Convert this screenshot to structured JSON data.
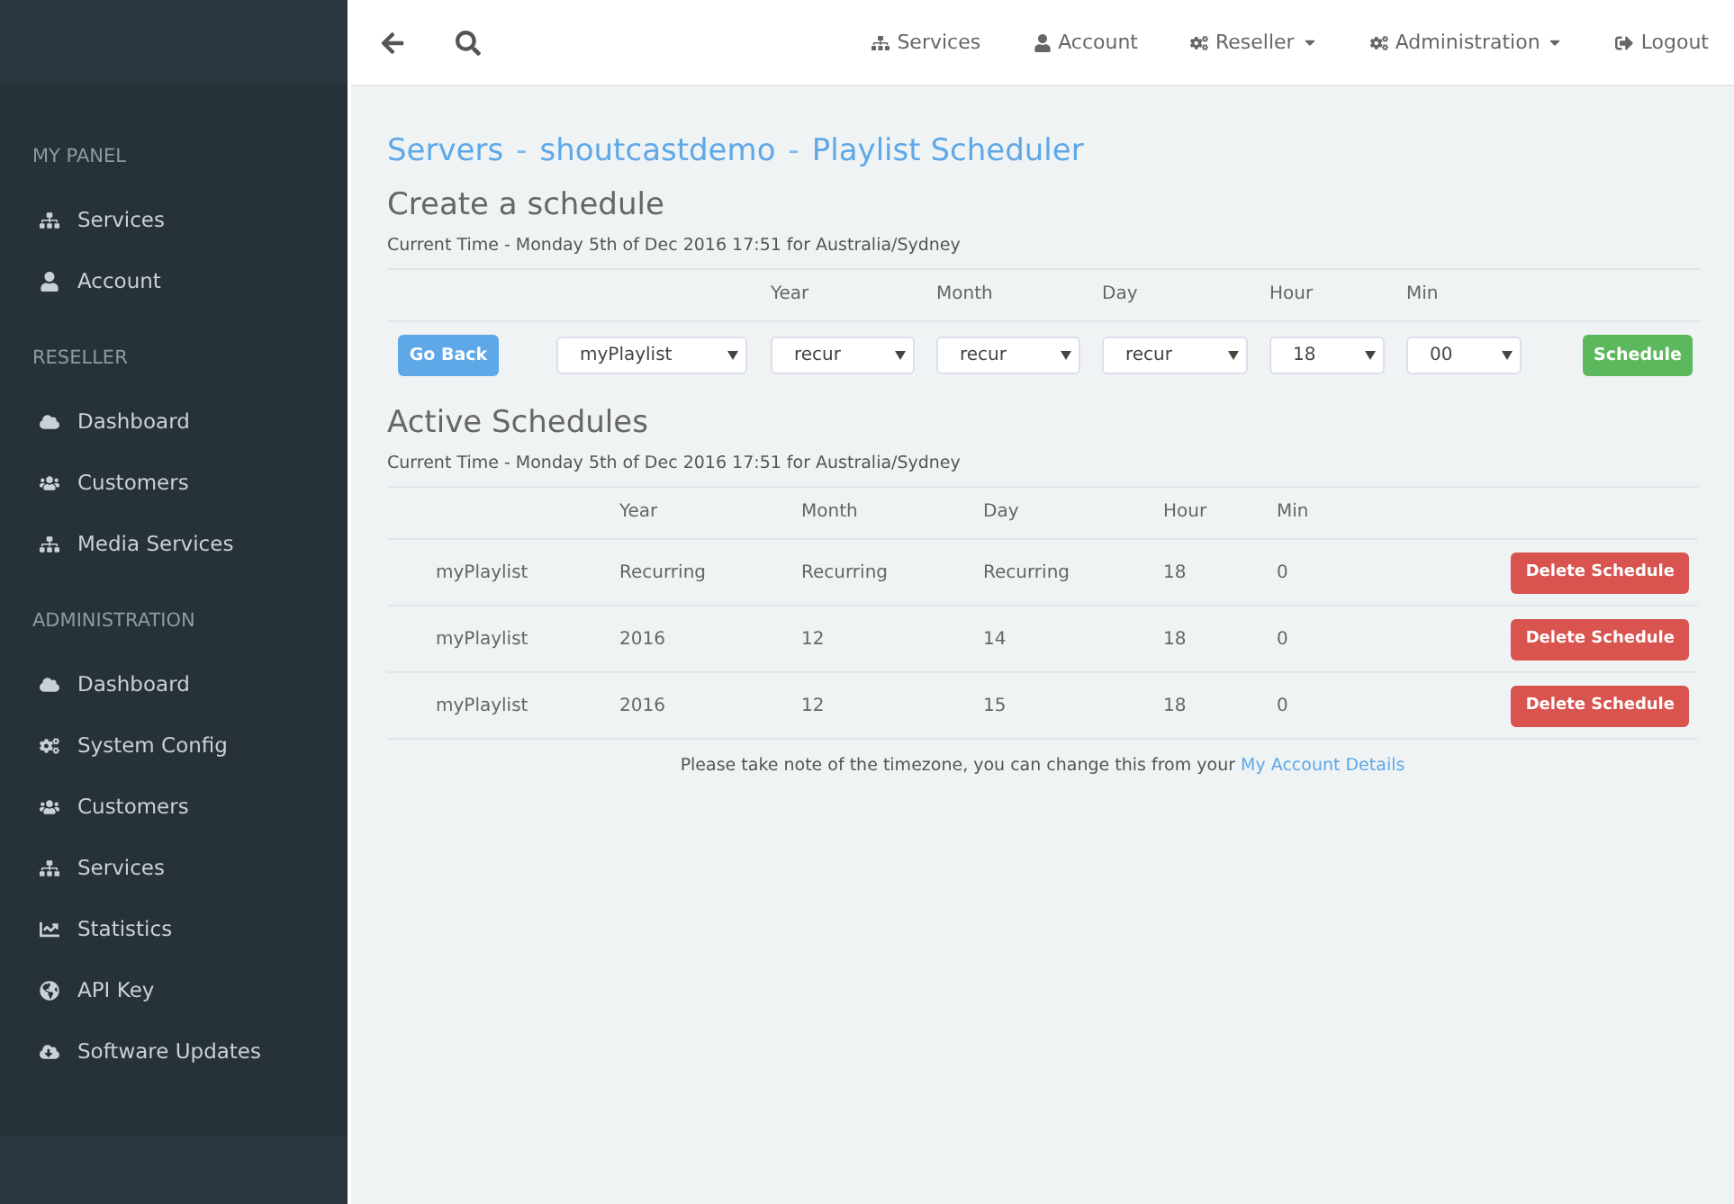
{
  "topbar": {
    "links": [
      {
        "label": "Services",
        "dropdown": false
      },
      {
        "label": "Account",
        "dropdown": false
      },
      {
        "label": "Reseller",
        "dropdown": true
      },
      {
        "label": "Administration",
        "dropdown": true
      },
      {
        "label": "Logout",
        "dropdown": false
      }
    ]
  },
  "sidebar": {
    "sections": [
      {
        "heading": "MY PANEL",
        "items": [
          "Services",
          "Account"
        ]
      },
      {
        "heading": "RESELLER",
        "items": [
          "Dashboard",
          "Customers",
          "Media Services"
        ]
      },
      {
        "heading": "ADMINISTRATION",
        "items": [
          "Dashboard",
          "System Config",
          "Customers",
          "Services",
          "Statistics",
          "API Key",
          "Software Updates"
        ]
      }
    ]
  },
  "breadcrumb": [
    {
      "kind": "link",
      "text": "Servers"
    },
    {
      "kind": "separator",
      "text": "-"
    },
    {
      "kind": "link",
      "text": "shoutcastdemo"
    },
    {
      "kind": "separator",
      "text": "-"
    },
    {
      "kind": "link",
      "text": "Playlist Scheduler"
    }
  ],
  "create": {
    "title": "Create a schedule",
    "time": "Current Time - Monday 5th of Dec 2016 17:51 for Australia/Sydney",
    "columns": [
      "Year",
      "Month",
      "Day",
      "Hour",
      "Min"
    ],
    "back_button": "Go Back",
    "selects": [
      "myPlaylist",
      "recur",
      "recur",
      "recur",
      "18",
      "00"
    ],
    "submit_button": "Schedule"
  },
  "active": {
    "title": "Active Schedules",
    "time": "Current Time - Monday 5th of Dec 2016 17:51 for Australia/Sydney",
    "columns": [
      "",
      "Year",
      "Month",
      "Day",
      "Hour",
      "Min"
    ],
    "rows": [
      {
        "cells": [
          "myPlaylist",
          "Recurring",
          "Recurring",
          "Recurring",
          "18",
          "0"
        ],
        "button": "Delete Schedule"
      },
      {
        "cells": [
          "myPlaylist",
          "2016",
          "12",
          "14",
          "18",
          "0"
        ],
        "button": "Delete Schedule"
      },
      {
        "cells": [
          "myPlaylist",
          "2016",
          "12",
          "15",
          "18",
          "0"
        ],
        "button": "Delete Schedule"
      }
    ]
  },
  "note": {
    "text": "Please take note of the timezone, you can change this from your",
    "link": "My Account Details"
  }
}
